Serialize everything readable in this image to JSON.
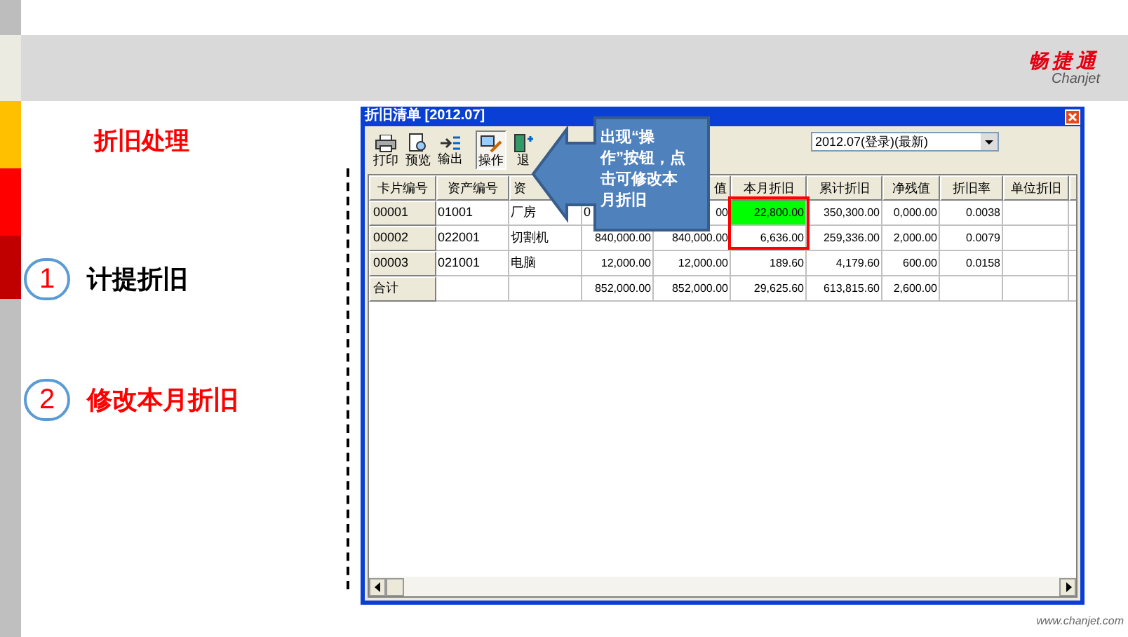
{
  "brand": {
    "name": "畅捷通",
    "latin": "Chanjet"
  },
  "slide": {
    "title": "折旧处理",
    "steps": [
      {
        "number": "1",
        "label": "计提折旧",
        "selected": false
      },
      {
        "number": "2",
        "label": "修改本月折旧",
        "selected": true
      }
    ],
    "footer": "www.chanjet.com"
  },
  "window": {
    "title": "折旧清单 [2012.07]",
    "toolbar": [
      {
        "label": "打印",
        "kind": "print",
        "selected": false
      },
      {
        "label": "预览",
        "kind": "preview",
        "selected": false
      },
      {
        "label": "输出",
        "kind": "export",
        "selected": false
      },
      {
        "label": "操作",
        "kind": "edit",
        "selected": true
      },
      {
        "label": "退",
        "kind": "exit",
        "selected": false
      }
    ],
    "period_select": {
      "value": "2012.07(登录)(最新)"
    },
    "table": {
      "columns": [
        "卡片编号",
        "资产编号",
        "资",
        null,
        "值",
        "本月折旧",
        "累计折旧",
        "净残值",
        "折旧率",
        "单位折旧",
        null
      ],
      "rows": [
        {
          "cells": [
            "00001",
            "01001",
            "厂房",
            "0",
            "00",
            {
              "text": "22,800.00",
              "highlighted": true
            },
            "350,300.00",
            "0,000.00",
            "0.0038",
            null,
            null
          ]
        },
        {
          "cells": [
            "00002",
            "022001",
            "切割机",
            "840,000.00",
            "840,000.00",
            {
              "text": "6,636.00",
              "highlighted": false
            },
            "259,336.00",
            "2,000.00",
            "0.0079",
            null,
            null
          ]
        },
        {
          "cells": [
            "00003",
            "021001",
            "电脑",
            "12,000.00",
            "12,000.00",
            {
              "text": "189.60",
              "highlighted": false
            },
            "4,179.60",
            "600.00",
            "0.0158",
            null,
            null
          ]
        },
        {
          "cells": [
            "合计",
            null,
            null,
            "852,000.00",
            "852,000.00",
            {
              "text": "29,625.60",
              "highlighted": false
            },
            "613,815.60",
            "2,600.00",
            null,
            null,
            null
          ]
        }
      ]
    },
    "callout": {
      "text": "出现“操作”按钮，点击可修改本月折旧"
    }
  }
}
